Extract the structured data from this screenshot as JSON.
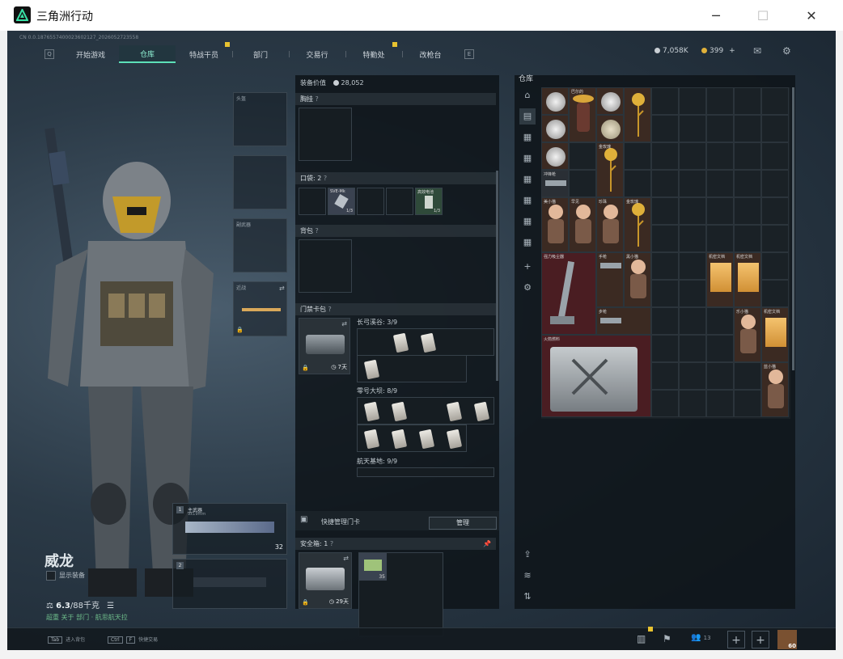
{
  "window": {
    "title": "三角洲行动",
    "controls": {
      "minimize": "─",
      "maximize": "☐",
      "close": "✕"
    }
  },
  "system_info": "CN 0.0.1876557400023602127_2026052723558",
  "nav": {
    "left_key": "Q",
    "right_key": "E",
    "tabs": [
      {
        "label": "开始游戏",
        "active": false
      },
      {
        "label": "仓库",
        "active": true
      },
      {
        "label": "特战干员",
        "active": false,
        "badge": true
      },
      {
        "label": "部门",
        "active": false
      },
      {
        "label": "交易行",
        "active": false
      },
      {
        "label": "特勤处",
        "active": false,
        "badge": true
      },
      {
        "label": "改枪台",
        "active": false
      }
    ]
  },
  "currency": {
    "silver": "7,058K",
    "gold": "399",
    "gold_plus": "+"
  },
  "operator": {
    "name": "威龙",
    "show_equipment_label": "显示装备",
    "weight": "6.3",
    "weight_max": "/88千克",
    "hint": "超重 关于 部门 · 航思航天拉"
  },
  "equipment": {
    "value_label": "装备价值",
    "value": "28,052",
    "chest_rig_label": "胸挂",
    "pockets_label": "口袋:",
    "pockets_count": "2",
    "backpack_label": "背包",
    "keycard_label": "门禁卡包",
    "keycard_days": "7天",
    "pocket_item_1": "SVE-Mk",
    "pocket_item_1_count": "1/3",
    "pocket_item_2": "高效电池",
    "pocket_item_2_count": "1/3",
    "maps": [
      {
        "name": "长弓溪谷:",
        "count": "3/9"
      },
      {
        "name": "零号大坝:",
        "count": "8/9"
      },
      {
        "name": "航天基地:",
        "count": "9/9"
      }
    ],
    "quick_manage_label": "快捷管理门卡",
    "manage_button": "管理",
    "safe_box_label": "安全箱:",
    "safe_box_count": "1",
    "safe_box_days": "29天",
    "safe_item_count": "35",
    "helmet_slot": "头盔",
    "sidearm_slot": "副武器",
    "melee_slot": "近战",
    "primary_label": "主武器",
    "primary_sub": "9x19mm",
    "primary_ammo": "32",
    "slot1": "1",
    "slot2": "2"
  },
  "warehouse": {
    "title": "仓库",
    "items": [
      {
        "label": "",
        "kind": "coin"
      },
      {
        "label": "巴尔的",
        "kind": "sombrero"
      },
      {
        "label": "",
        "kind": "coin"
      },
      {
        "label": "",
        "kind": "rose"
      },
      {
        "label": "",
        "kind": "coin"
      },
      {
        "label": "",
        "kind": "moon"
      },
      {
        "label": "",
        "kind": "coin"
      },
      {
        "label": "金玫瑰",
        "kind": "rose"
      },
      {
        "label": "冲锋枪",
        "kind": "gun"
      },
      {
        "label": "美小猫",
        "kind": "figure"
      },
      {
        "label": "早见",
        "kind": "figure"
      },
      {
        "label": "珍珠",
        "kind": "figure"
      },
      {
        "label": "金玫瑰",
        "kind": "rose"
      },
      {
        "label": "强力吸尘器",
        "kind": "vacuum"
      },
      {
        "label": "手枪",
        "kind": "gun"
      },
      {
        "label": "黑小猫",
        "kind": "figure"
      },
      {
        "label": "机密文档",
        "kind": "doc"
      },
      {
        "label": "机密文档",
        "kind": "doc"
      },
      {
        "label": "步枪",
        "kind": "gun"
      },
      {
        "label": "乐小猫",
        "kind": "figure"
      },
      {
        "label": "机密文档",
        "kind": "doc"
      },
      {
        "label": "火箭燃料",
        "kind": "canister"
      },
      {
        "label": "蓝小猫",
        "kind": "figure"
      }
    ]
  },
  "bottom": {
    "hint_1_key": "Tab",
    "hint_1": "进入背包",
    "hint_2_key": "Ctrl",
    "hint_2_key2": "F",
    "hint_2": "快捷交易",
    "team_count": "13",
    "level": "60"
  }
}
